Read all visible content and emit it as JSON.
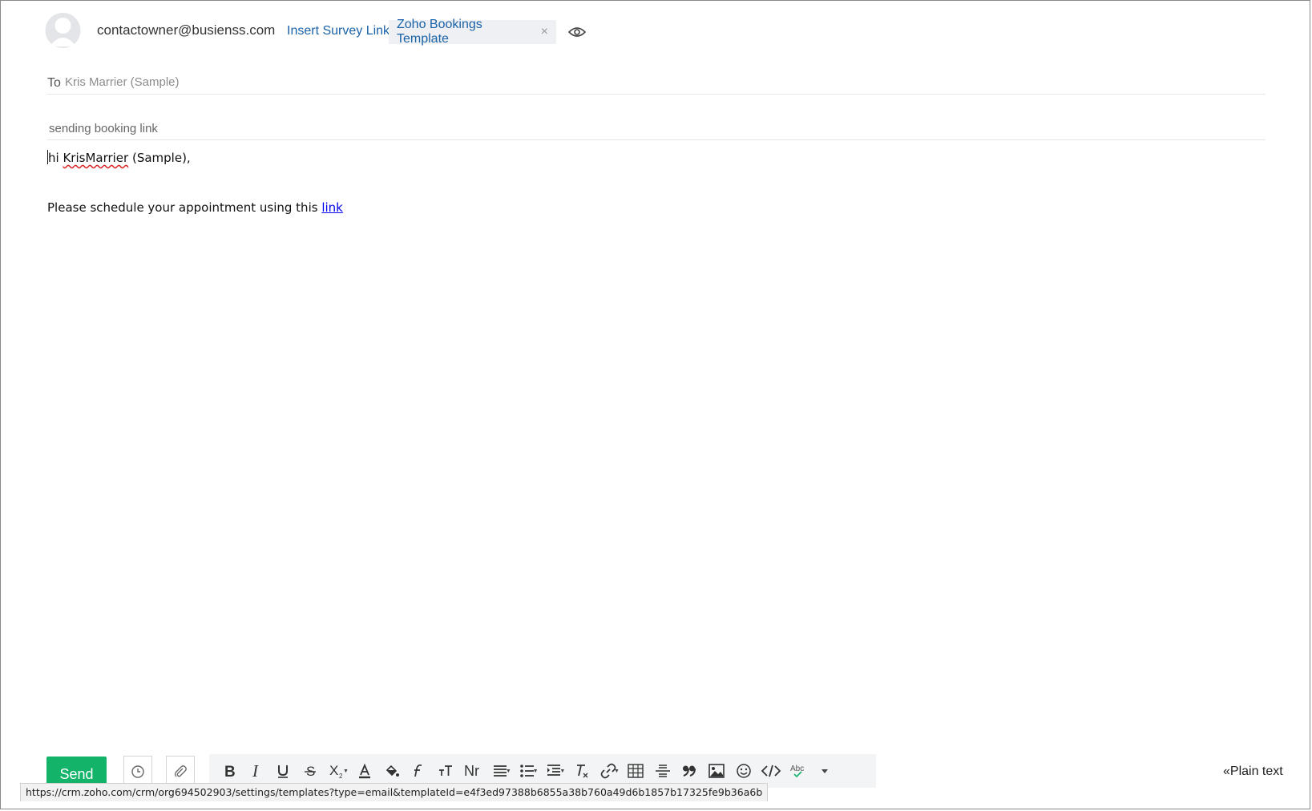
{
  "header": {
    "from_email": "contactowner@busienss.com",
    "insert_survey_link": "Insert Survey Link",
    "template_chip": "Zoho Bookings Template",
    "template_chip_close": "×"
  },
  "to": {
    "label": "To",
    "value": "Kris Marrier (Sample)"
  },
  "subject": {
    "value": "sending booking link"
  },
  "body": {
    "greeting_prefix": "hi ",
    "greeting_name": "KrisMarrier",
    "greeting_suffix": " (Sample),",
    "message_text": "Please schedule your appointment using this ",
    "link_text": "link"
  },
  "footer": {
    "send_label": "Send",
    "plain_text_label": "«Plain text",
    "status_url": "https://crm.zoho.com/crm/org694502903/settings/templates?type=email&templateId=e4f3ed97388b6855a38b760a49d6b1857b17325fe9b36a6b"
  },
  "colors": {
    "send_green": "#13b46a",
    "link_blue": "#1a62a8",
    "toolbar_bg": "#f3f4f5"
  },
  "icons": [
    "avatar-icon",
    "eye-icon",
    "clock-icon",
    "attachment-icon",
    "bold-icon",
    "italic-icon",
    "underline-icon",
    "strikethrough-icon",
    "subscript-icon",
    "font-color-icon",
    "fill-color-icon",
    "font-family-icon",
    "font-size-icon",
    "text-case-icon",
    "align-icon",
    "list-icon",
    "indent-icon",
    "clear-format-icon",
    "link-icon",
    "table-icon",
    "horizontal-line-icon",
    "quote-icon",
    "image-icon",
    "emoji-icon",
    "code-icon",
    "spellcheck-icon",
    "more-icon"
  ]
}
